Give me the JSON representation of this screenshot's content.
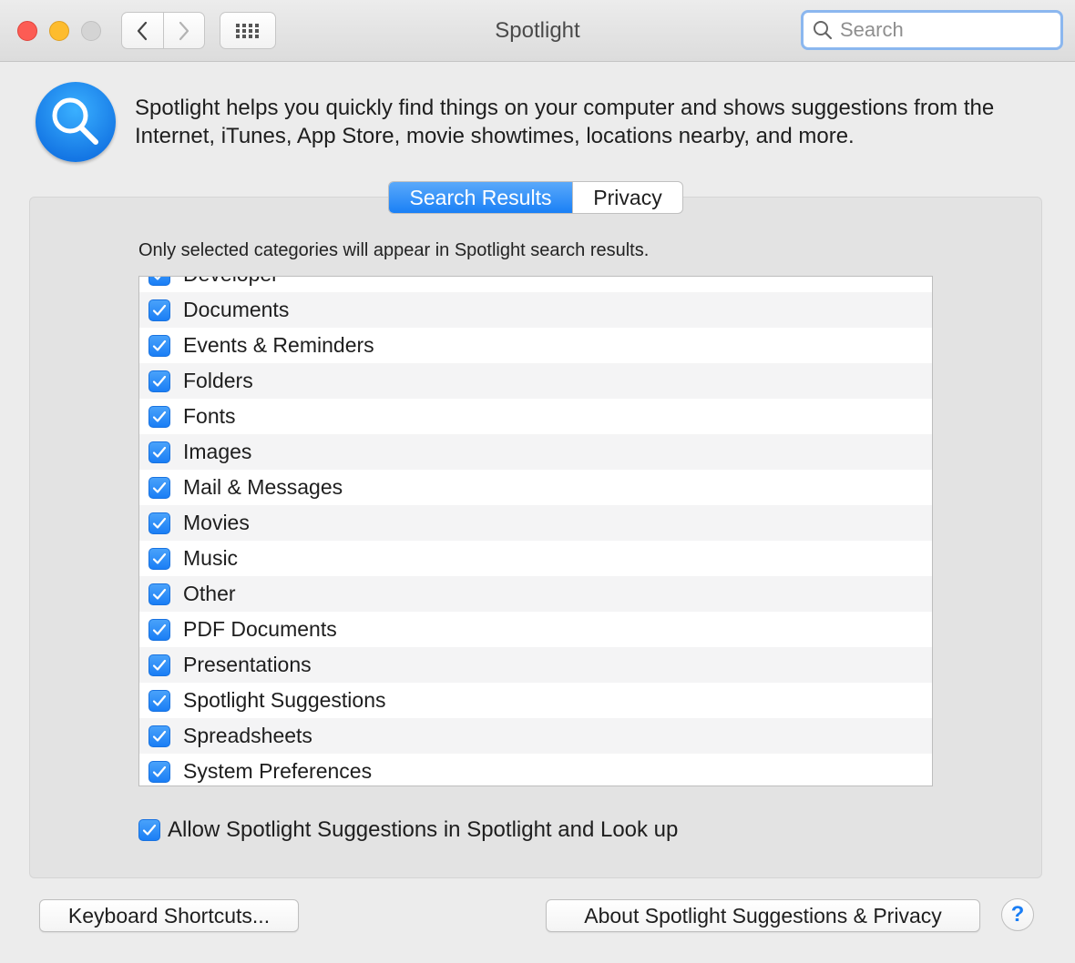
{
  "window": {
    "title": "Spotlight",
    "search_placeholder": "Search"
  },
  "header": {
    "description": "Spotlight helps you quickly find things on your computer and shows suggestions from the Internet, iTunes, App Store, movie showtimes, locations nearby, and more."
  },
  "tabs": [
    {
      "label": "Search Results",
      "selected": true
    },
    {
      "label": "Privacy",
      "selected": false
    }
  ],
  "search_results": {
    "hint": "Only selected categories will appear in Spotlight search results.",
    "categories": [
      {
        "label": "Developer",
        "checked": true
      },
      {
        "label": "Documents",
        "checked": true
      },
      {
        "label": "Events & Reminders",
        "checked": true
      },
      {
        "label": "Folders",
        "checked": true
      },
      {
        "label": "Fonts",
        "checked": true
      },
      {
        "label": "Images",
        "checked": true
      },
      {
        "label": "Mail & Messages",
        "checked": true
      },
      {
        "label": "Movies",
        "checked": true
      },
      {
        "label": "Music",
        "checked": true
      },
      {
        "label": "Other",
        "checked": true
      },
      {
        "label": "PDF Documents",
        "checked": true
      },
      {
        "label": "Presentations",
        "checked": true
      },
      {
        "label": "Spotlight Suggestions",
        "checked": true
      },
      {
        "label": "Spreadsheets",
        "checked": true
      },
      {
        "label": "System Preferences",
        "checked": true
      }
    ],
    "allow_label": "Allow Spotlight Suggestions in Spotlight and Look up",
    "allow_checked": true
  },
  "footer": {
    "shortcuts_label": "Keyboard Shortcuts...",
    "about_label": "About Spotlight Suggestions & Privacy",
    "help_label": "?"
  },
  "colors": {
    "accent": "#1a80f6",
    "close": "#fc5c54",
    "minimize": "#fdbc2e",
    "zoom_disabled": "#d4d4d4"
  }
}
